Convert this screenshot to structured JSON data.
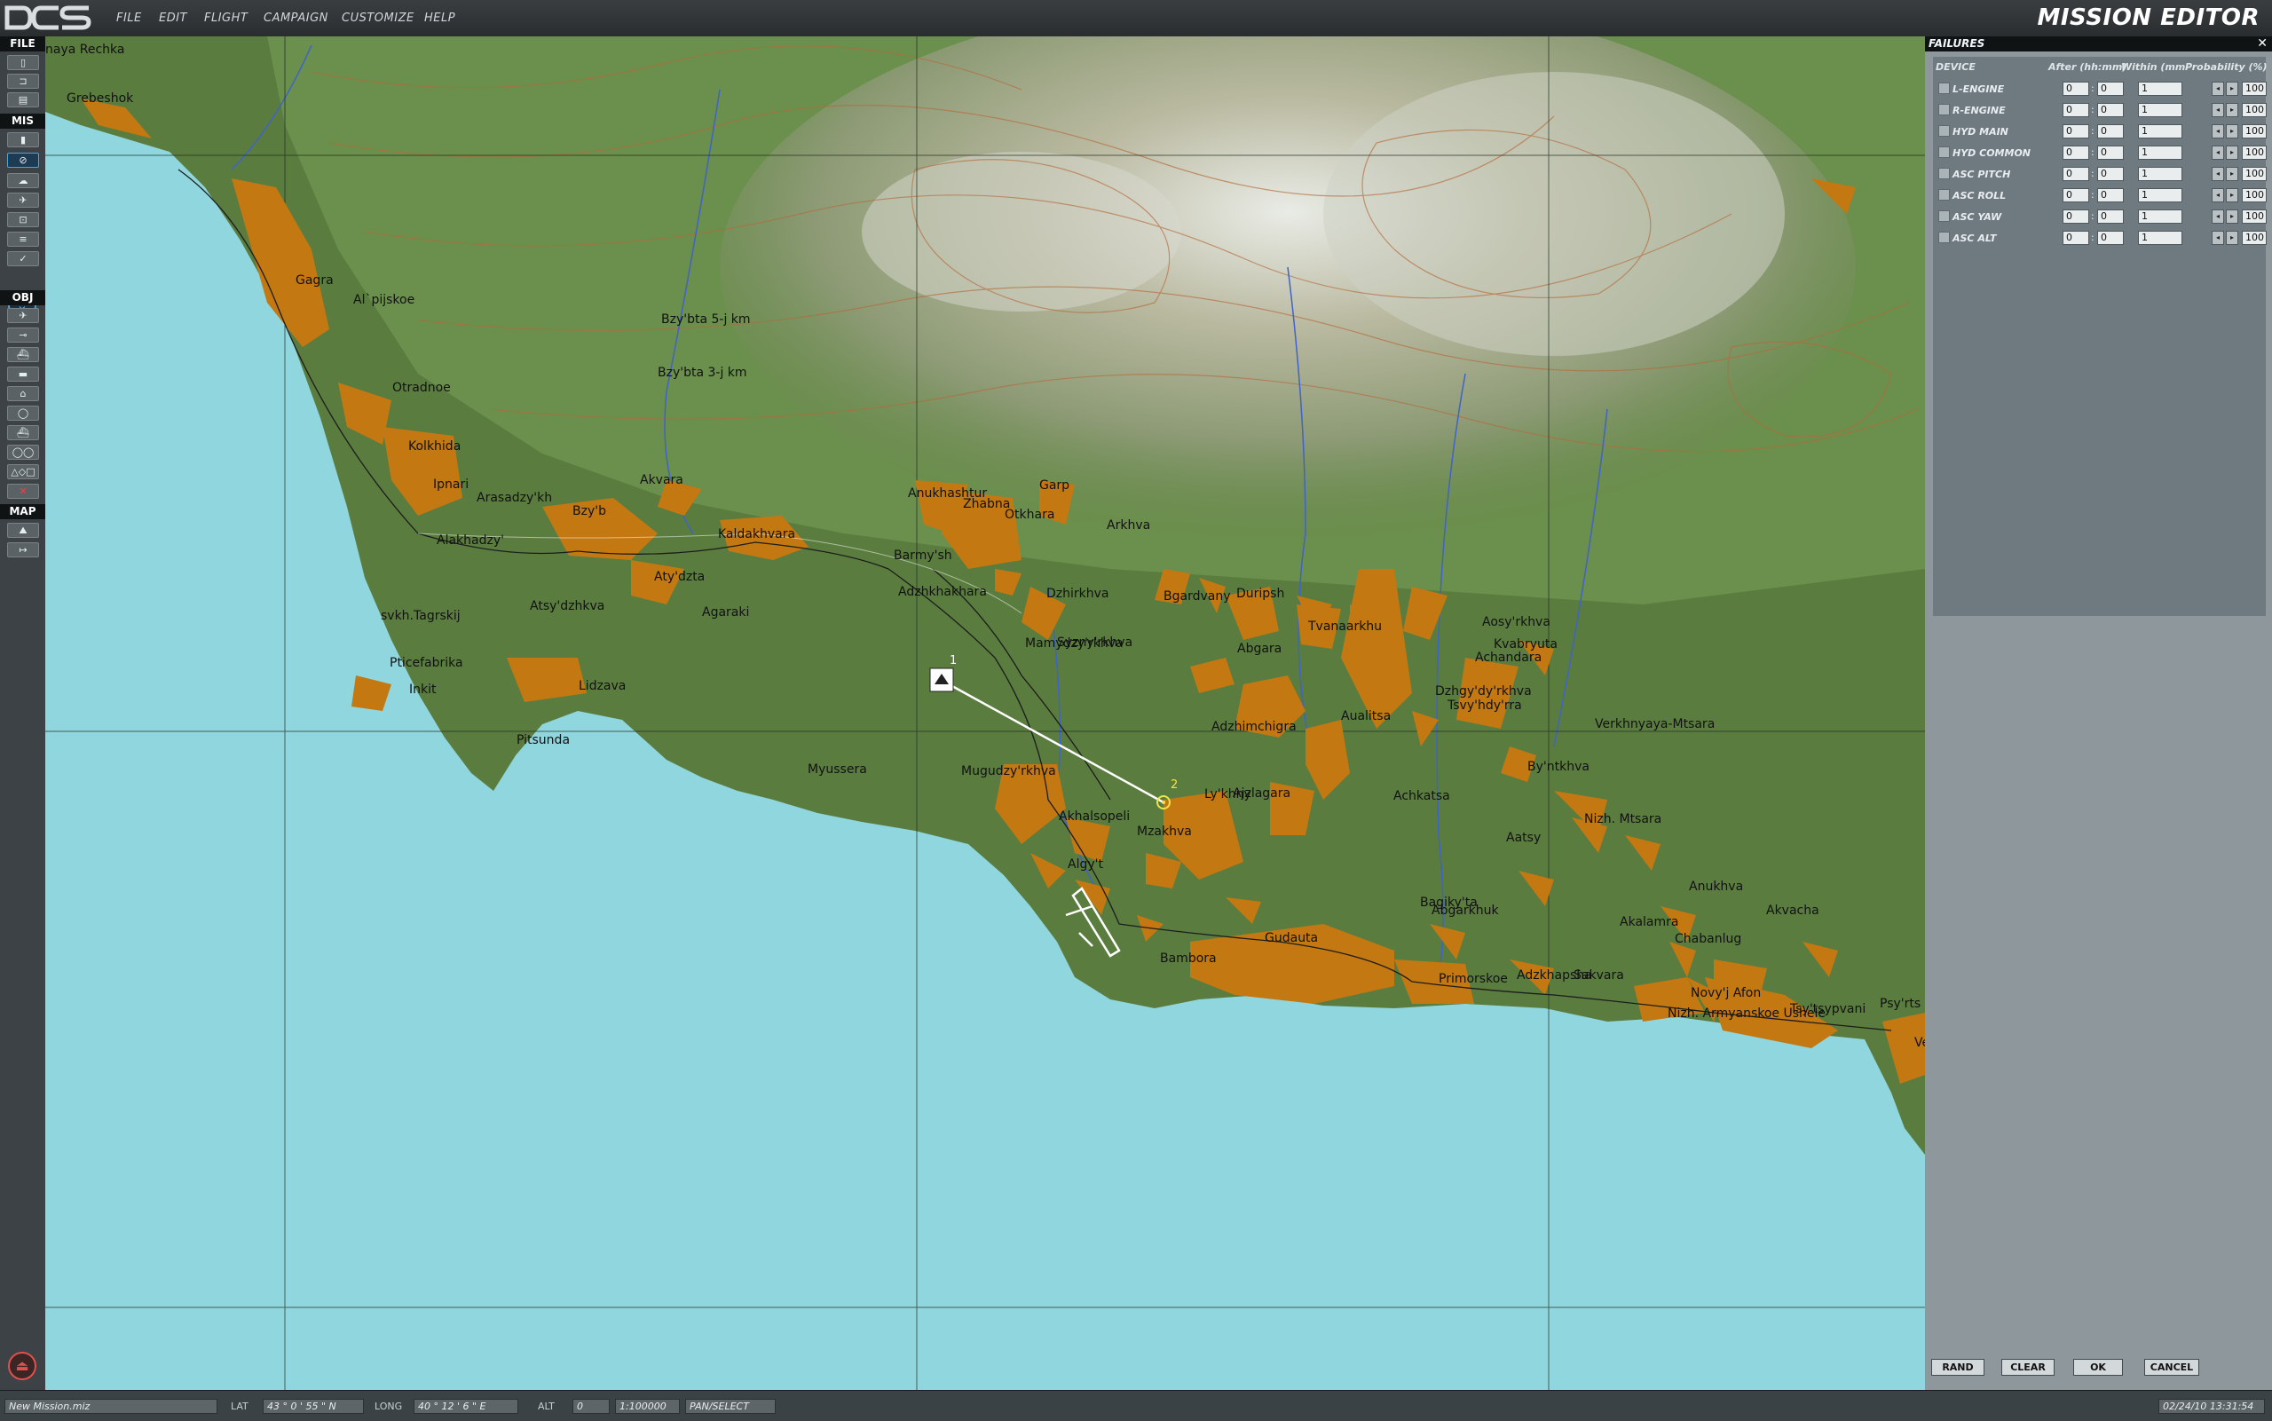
{
  "app": {
    "logo": "DCS",
    "title": "MISSION EDITOR"
  },
  "menu": [
    "FILE",
    "EDIT",
    "FLIGHT",
    "CAMPAIGN",
    "CUSTOMIZE",
    "HELP"
  ],
  "toolbar": {
    "sections": {
      "file": "FILE",
      "mis": "MIS",
      "obj": "OBJ",
      "map": "MAP"
    },
    "icons": [
      "new-icon",
      "open-icon",
      "save-icon",
      "trigger-icon",
      "failures-icon",
      "weather-icon",
      "airplane-icon",
      "goals-icon",
      "briefing-icon",
      "checkmark-icon",
      "down-arrow-icon",
      "plane-icon",
      "helicopter-icon",
      "ship-icon",
      "ground-unit-icon",
      "static-icon",
      "trigger-zone-icon",
      "template-icon",
      "nav-points-icon",
      "shapes-icon",
      "delete-icon",
      "map-options-icon",
      "ruler-icon",
      "eject-icon"
    ]
  },
  "failures": {
    "title": "FAILURES",
    "headers": {
      "device": "DEVICE",
      "after": "After (hh:mm)",
      "within": "Within (mm",
      "probability": "Probability (%)"
    },
    "rows": [
      {
        "name": "L-ENGINE",
        "hh": "0",
        "mm": "0",
        "within": "1",
        "prob": "100"
      },
      {
        "name": "R-ENGINE",
        "hh": "0",
        "mm": "0",
        "within": "1",
        "prob": "100"
      },
      {
        "name": "HYD MAIN",
        "hh": "0",
        "mm": "0",
        "within": "1",
        "prob": "100"
      },
      {
        "name": "HYD COMMON",
        "hh": "0",
        "mm": "0",
        "within": "1",
        "prob": "100"
      },
      {
        "name": "ASC PITCH",
        "hh": "0",
        "mm": "0",
        "within": "1",
        "prob": "100"
      },
      {
        "name": "ASC ROLL",
        "hh": "0",
        "mm": "0",
        "within": "1",
        "prob": "100"
      },
      {
        "name": "ASC YAW",
        "hh": "0",
        "mm": "0",
        "within": "1",
        "prob": "100"
      },
      {
        "name": "ASC ALT",
        "hh": "0",
        "mm": "0",
        "within": "1",
        "prob": "100"
      }
    ],
    "buttons": {
      "rand": "RAND",
      "clear": "CLEAR",
      "ok": "OK",
      "cancel": "CANCEL"
    }
  },
  "map": {
    "waypoints": [
      "1",
      "2"
    ],
    "towns": [
      "naya Rechka",
      "Grebeshok",
      "Gagra",
      "Al`pijskoe",
      "Bzy'bta 5-j km",
      "Bzy'bta 3-j km",
      "Otradnoe",
      "Kolkhida",
      "Ipnari",
      "Arasadzy'kh",
      "Bzy'b",
      "Akvara",
      "Alakhadzy'",
      "Kaldakhvara",
      "Anukhashtur",
      "Zhabna",
      "Garp",
      "Otkhara",
      "Arkhva",
      "Barmy'sh",
      "Adzhkhakhara",
      "Aty'dzta",
      "Agaraki",
      "Dzhirkhva",
      "Bgardvany",
      "Duripsh",
      "Tvanaarkhu",
      "Aosy'rkhva",
      "Kvabryuta",
      "Achandara",
      "svkh.Tagrskij",
      "Atsy'dzhkva",
      "Mamydzy'rkhva",
      "Syzny'rkhva",
      "Abgara",
      "Pticefabrika",
      "Inkit",
      "Lidzava",
      "Adzhimchigra",
      "Aualitsa",
      "Dzhgy'dy'rkhva",
      "Tsvy'hdy'rra",
      "Verkhnyaya-Mtsara",
      "Pitsunda",
      "Myussera",
      "Mugudzy'rkhva",
      "By'ntkhva",
      "Ly'khny",
      "Ajzlagara",
      "Achkatsa",
      "Nizh. Mtsara",
      "Aatsy",
      "Akhalsopeli",
      "Mzakhva",
      "Algy't",
      "Bagiky'ta",
      "Anukhva",
      "Akvacha",
      "Abgarkhuk",
      "Akalamra",
      "Chabanlug",
      "Gudauta",
      "Bambora",
      "Primorskoe",
      "Adzkhapsha",
      "Sakvara",
      "Novy'j Afon",
      "Tsy'tsypvani",
      "Psy'rts",
      "Nizh. Armyanskoe Ushele",
      "Ve"
    ]
  },
  "status": {
    "mission": "New Mission.miz",
    "lat_label": "LAT",
    "lat": "43 ° 0 ' 55 \" N",
    "long_label": "LONG",
    "long": "40 ° 12 ' 6 \" E",
    "alt_label": "ALT",
    "alt": "0",
    "scale": "1:100000",
    "mode": "PAN/SELECT",
    "datetime": "02/24/10 13:31:54"
  },
  "colors": {
    "sea": "#8fd6df",
    "land": "#557a3c",
    "towns": "#c47812",
    "panel": "#8d979c",
    "accent": "#4fa3d8"
  }
}
